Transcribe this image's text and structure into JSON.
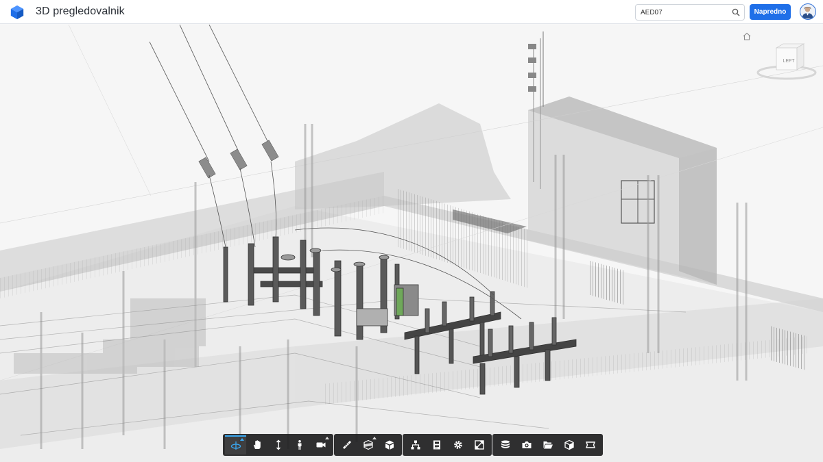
{
  "header": {
    "app_title": "3D pregledovalnik",
    "logo_icon": "cube-logo-icon",
    "search": {
      "value": "AED07",
      "placeholder": "",
      "icon": "search-icon"
    },
    "advanced_label": "Napredno",
    "avatar_icon": "user-avatar"
  },
  "viewer": {
    "home_icon": "home-icon",
    "viewcube": {
      "face_label": "LEFT"
    }
  },
  "toolbar": {
    "groups": [
      {
        "name": "navigation",
        "buttons": [
          {
            "name": "orbit-icon",
            "active": true,
            "submenu": true
          },
          {
            "name": "pan-icon",
            "active": false,
            "submenu": false
          },
          {
            "name": "zoom-icon",
            "active": false,
            "submenu": false
          },
          {
            "name": "first-person-icon",
            "active": false,
            "submenu": false
          },
          {
            "name": "camera-icon",
            "active": false,
            "submenu": true
          }
        ]
      },
      {
        "name": "tools",
        "buttons": [
          {
            "name": "measure-icon",
            "active": false,
            "submenu": false
          },
          {
            "name": "section-icon",
            "active": false,
            "submenu": true
          },
          {
            "name": "explode-icon",
            "active": false,
            "submenu": false
          }
        ]
      },
      {
        "name": "model",
        "buttons": [
          {
            "name": "model-browser-icon",
            "active": false,
            "submenu": false
          },
          {
            "name": "properties-icon",
            "active": false,
            "submenu": false
          },
          {
            "name": "settings-icon",
            "active": false,
            "submenu": false
          },
          {
            "name": "fullscreen-icon",
            "active": false,
            "submenu": false
          }
        ]
      },
      {
        "name": "extras",
        "buttons": [
          {
            "name": "layers-icon",
            "active": false,
            "submenu": false
          },
          {
            "name": "screenshot-icon",
            "active": false,
            "submenu": false
          },
          {
            "name": "open-folder-icon",
            "active": false,
            "submenu": false
          },
          {
            "name": "cube-view-icon",
            "active": false,
            "submenu": false
          },
          {
            "name": "area-icon",
            "active": false,
            "submenu": false
          }
        ]
      }
    ]
  }
}
